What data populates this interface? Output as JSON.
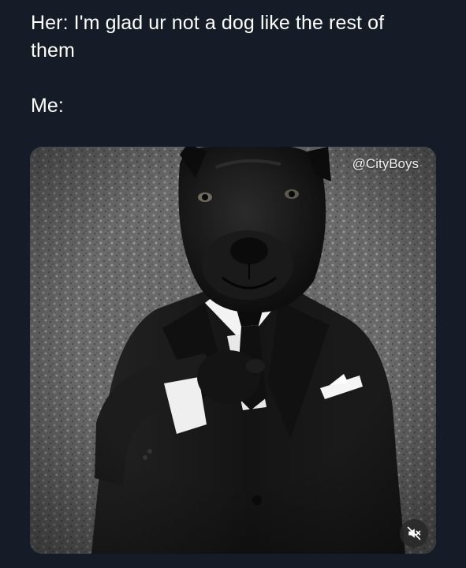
{
  "post": {
    "text_lines": [
      "Her: I'm glad ur not a dog like the rest of",
      "them",
      "Me:"
    ]
  },
  "media": {
    "type": "photo",
    "watermark": "@CityBoys",
    "mute_button_icon": "speaker-muted-icon",
    "colors": {
      "background": "#151c27",
      "text": "#ffffff",
      "ground": "#6b6b6b",
      "suit": "#1b1b1b",
      "shirt": "#f4f4f4"
    }
  }
}
